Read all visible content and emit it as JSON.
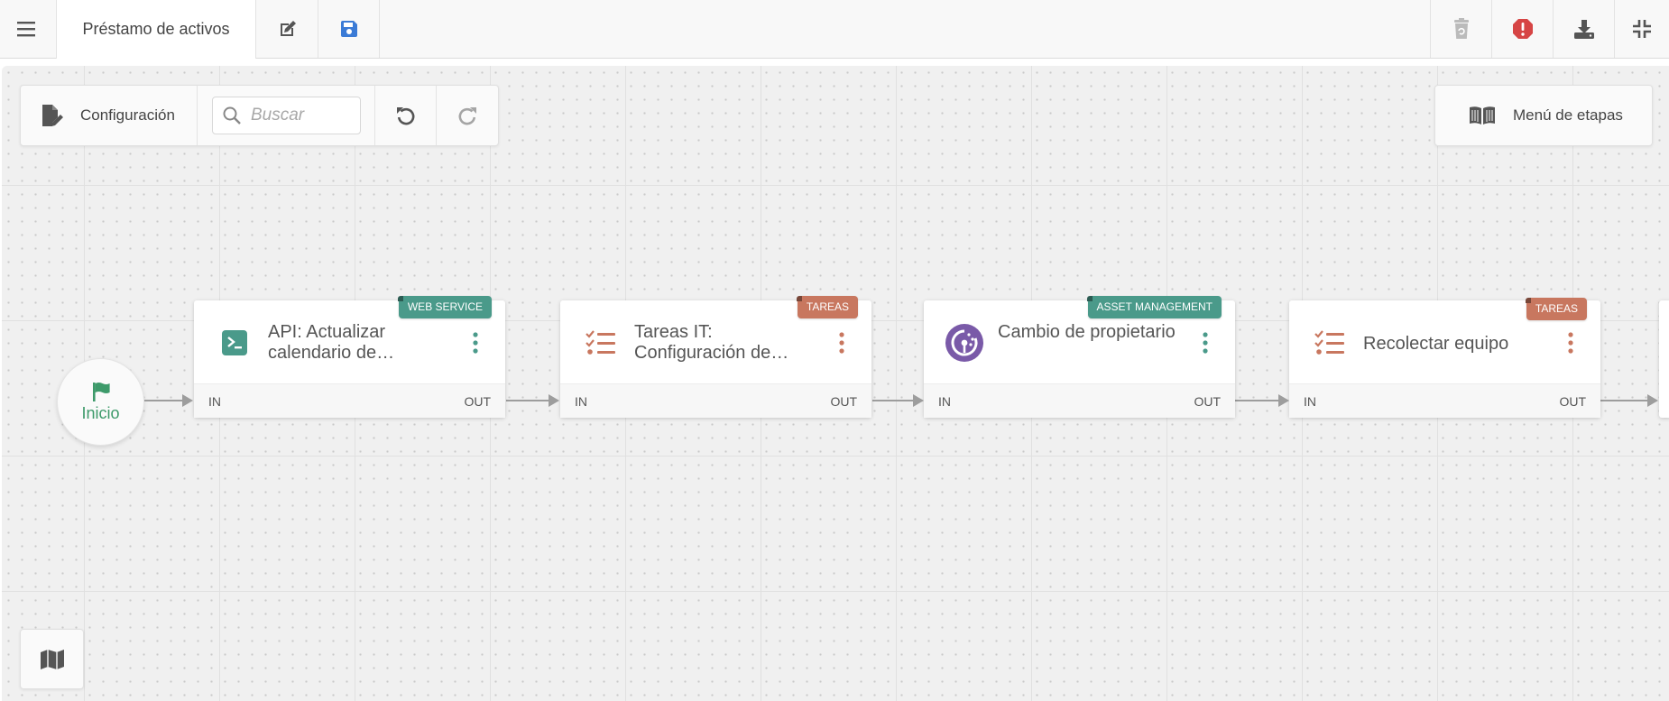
{
  "toolbar": {
    "title": "Préstamo de activos",
    "icons": [
      "menu-icon",
      "edit-icon",
      "save-icon",
      "restore-trash-icon",
      "error-icon",
      "download-icon",
      "collapse-icon"
    ]
  },
  "tools": {
    "config_label": "Configuración",
    "search_placeholder": "Buscar",
    "stage_menu_label": "Menú de etapas"
  },
  "flow": {
    "start_label": "Inicio",
    "stages": [
      {
        "name": "API: Actualizar calendario de…",
        "badge": "WEB SERVICE",
        "in": "IN",
        "out": "OUT",
        "icon": "terminal-icon",
        "color": "#4a9a8a"
      },
      {
        "name": "Tareas IT: Configuración de…",
        "badge": "TAREAS",
        "in": "IN",
        "out": "OUT",
        "icon": "checklist-icon",
        "color": "#c8775f"
      },
      {
        "name": "Cambio de propietario",
        "badge": "ASSET MANAGEMENT",
        "in": "IN",
        "out": "OUT",
        "icon": "owner-icon",
        "color": "#4a9a8a"
      },
      {
        "name": "Recolectar equipo",
        "badge": "TAREAS",
        "in": "IN",
        "out": "OUT",
        "icon": "checklist-icon",
        "color": "#c8775f"
      }
    ]
  },
  "colors": {
    "teal": "#4a9a8a",
    "terracotta": "#c8775f",
    "purple": "#7a5aa8",
    "save_blue": "#3b7bd6",
    "error_red": "#d64545",
    "start_green": "#3d9a6a"
  }
}
